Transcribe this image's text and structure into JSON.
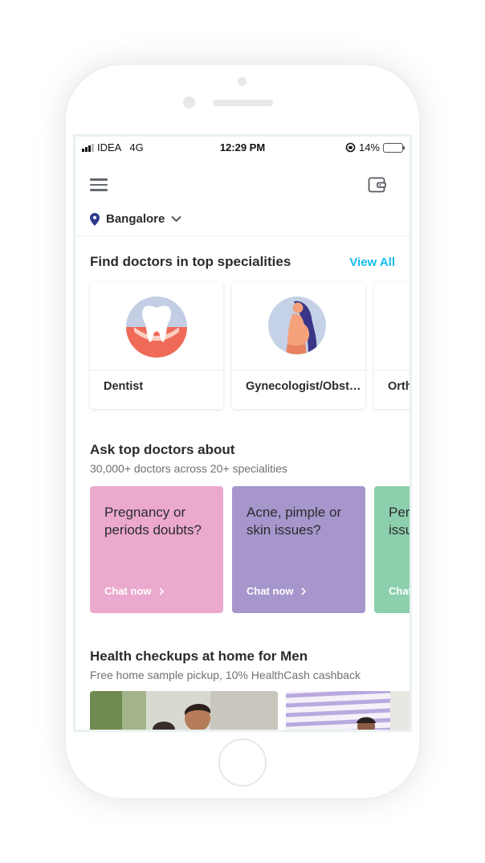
{
  "status_bar": {
    "carrier": "IDEA",
    "network": "4G",
    "time": "12:29 PM",
    "battery": "14%",
    "battery_level": 0.14,
    "battery_color": "#f5c518"
  },
  "header": {
    "menu_icon": "hamburger-menu-icon",
    "wallet_icon": "wallet-icon",
    "location": "Bangalore"
  },
  "specialities": {
    "title": "Find doctors in top specialities",
    "view_all": "View All",
    "accent": "#14bef0",
    "items": [
      {
        "label": "Dentist",
        "icon": "tooth-icon"
      },
      {
        "label": "Gynecologist/Obstetrician",
        "icon": "pregnant-woman-icon"
      },
      {
        "label": "Orthopedist",
        "icon": "bone-icon"
      }
    ]
  },
  "ask": {
    "title": "Ask top doctors about",
    "subtitle": "30,000+ doctors across 20+ specialities",
    "items": [
      {
        "question": "Pregnancy or periods doubts?",
        "cta": "Chat now",
        "color": "#eba9cd"
      },
      {
        "question": "Acne, pimple or skin issues?",
        "cta": "Chat now",
        "color": "#a696cc"
      },
      {
        "question": "Performance issues?",
        "cta": "Chat now",
        "color": "#8ccfac"
      }
    ]
  },
  "checkups": {
    "title": "Health checkups at home for Men",
    "subtitle": "Free home sample pickup, 10% HealthCash cashback"
  }
}
